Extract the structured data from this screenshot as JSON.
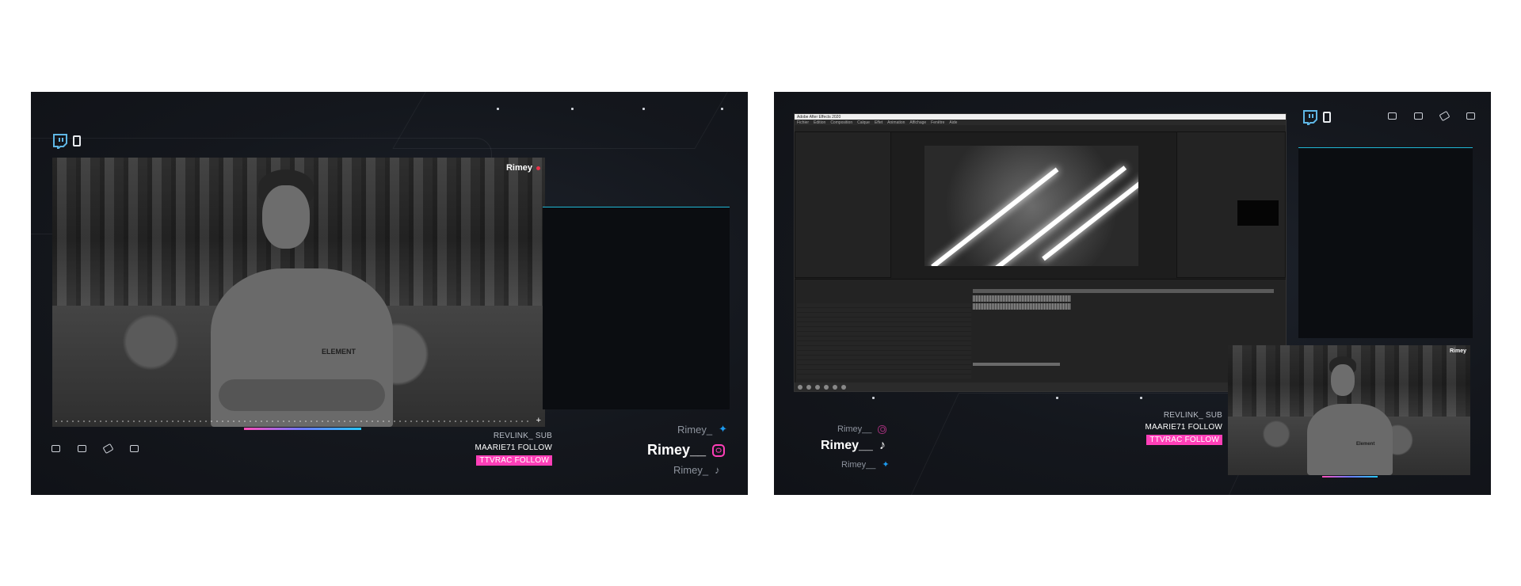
{
  "colors": {
    "accent_cyan": "#1fb6d4",
    "accent_pink": "#ff3fb8",
    "live_red": "#e8334a",
    "panel_bg": "#14171d"
  },
  "left": {
    "cam_label": "Rimey",
    "alerts": {
      "sub": "REVLINK_  SUB",
      "follow": "MAARIE71  FOLLOW",
      "highlight": "TTVRAC  FOLLOW"
    },
    "socials": [
      {
        "handle": "Rimey_",
        "icon": "twitter-icon"
      },
      {
        "handle": "Rimey__",
        "icon": "instagram-icon"
      },
      {
        "handle": "Rimey_",
        "icon": "tiktok-icon"
      }
    ],
    "bottom_icons": [
      "share-icon",
      "copy-icon",
      "tag-icon",
      "image-off-icon"
    ],
    "photo_logo": "ELEMENT"
  },
  "right": {
    "cam_label": "Rimey",
    "alerts": {
      "sub": "REVLINK_  SUB",
      "follow": "MAARIE71  FOLLOW",
      "highlight": "TTVRAC  FOLLOW"
    },
    "socials": [
      {
        "handle": "Rimey__",
        "icon": "instagram-icon"
      },
      {
        "handle": "Rimey__",
        "icon": "tiktok-icon"
      },
      {
        "handle": "Rimey__",
        "icon": "twitter-icon"
      }
    ],
    "top_icons": [
      "share-icon",
      "copy-icon",
      "tag-icon",
      "image-off-icon"
    ],
    "photo_logo": "Element",
    "ae_window": {
      "title": "Adobe After Effects 2020",
      "menu": [
        "Fichier",
        "Edition",
        "Composition",
        "Calque",
        "Effet",
        "Animation",
        "Affichage",
        "Fenêtre",
        "Aide"
      ]
    }
  }
}
